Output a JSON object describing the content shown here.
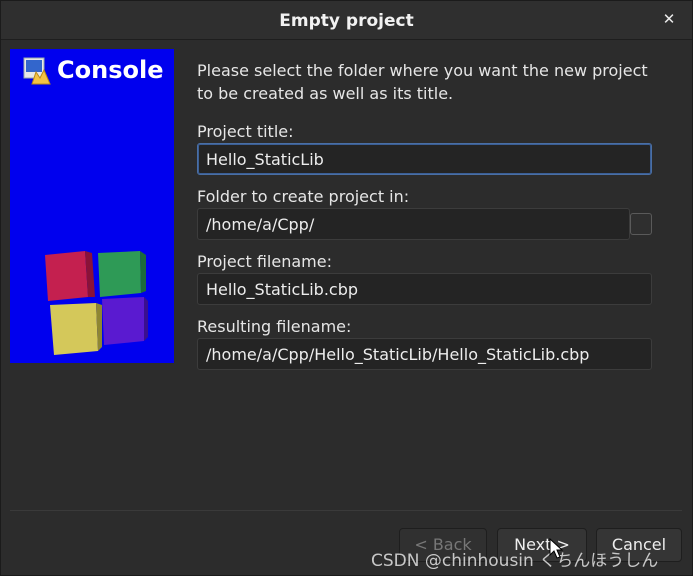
{
  "window": {
    "title": "Empty project",
    "close_icon": "close-icon"
  },
  "banner": {
    "text": "Console",
    "logo_icon": "codeblocks-logo-icon",
    "background": "#0000ee"
  },
  "intro": "Please select the folder where you want the new project to be created as well as its title.",
  "fields": {
    "project_title": {
      "label": "Project title:",
      "value": "Hello_StaticLib"
    },
    "folder": {
      "label": "Folder to create project in:",
      "value": "/home/a/Cpp/"
    },
    "project_filename": {
      "label": "Project filename:",
      "value": "Hello_StaticLib.cbp"
    },
    "resulting_filename": {
      "label": "Resulting filename:",
      "value": "/home/a/Cpp/Hello_StaticLib/Hello_StaticLib.cbp"
    }
  },
  "buttons": {
    "back": "< Back",
    "next": "Next >",
    "cancel": "Cancel"
  },
  "watermark": "CSDN @chinhousin くちんほうしん"
}
